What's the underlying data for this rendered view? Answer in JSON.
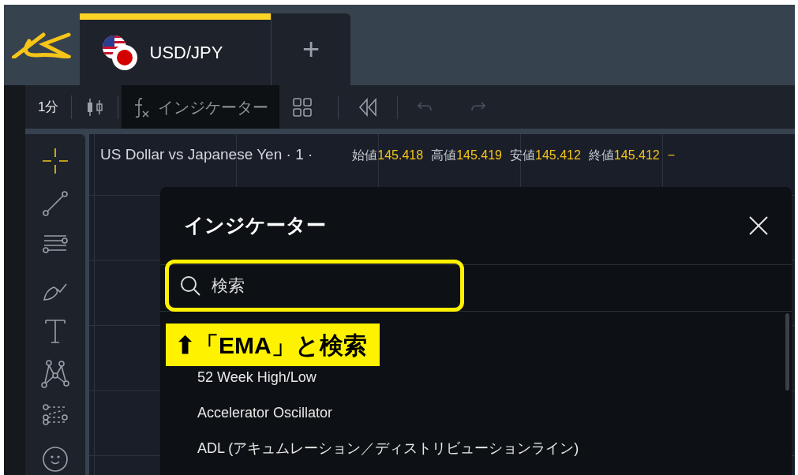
{
  "tabs": [
    {
      "label": "USD/JPY",
      "selected": true
    },
    {
      "label": "+",
      "selected": false
    }
  ],
  "toolbar": {
    "interval": "1分",
    "indicator_button": "インジケーター"
  },
  "tools": [
    {
      "kind": "crosshair",
      "selected": true
    },
    {
      "kind": "trendline",
      "selected": false
    },
    {
      "kind": "lines",
      "selected": false
    },
    {
      "kind": "brush",
      "selected": false
    },
    {
      "kind": "text",
      "selected": false
    },
    {
      "kind": "pattern",
      "selected": false
    },
    {
      "kind": "fib",
      "selected": false
    },
    {
      "kind": "emoji",
      "selected": false
    }
  ],
  "legend": {
    "title": "US Dollar vs Japanese Yen · 1 ·",
    "values": [
      {
        "label": "始値",
        "value": "145.418"
      },
      {
        "label": "高値",
        "value": "145.419"
      },
      {
        "label": "安値",
        "value": "145.412"
      },
      {
        "label": "終値",
        "value": "145.412"
      }
    ],
    "change": "−"
  },
  "dialog": {
    "title": "インジケーター",
    "search": {
      "placeholder": "検索"
    },
    "items": [
      "52 Week High/Low",
      "Accelerator Oscillator",
      "ADL (アキュムレーション／ディストリビューションライン)"
    ]
  },
  "annotation": "⬆「EMA」と検索"
}
